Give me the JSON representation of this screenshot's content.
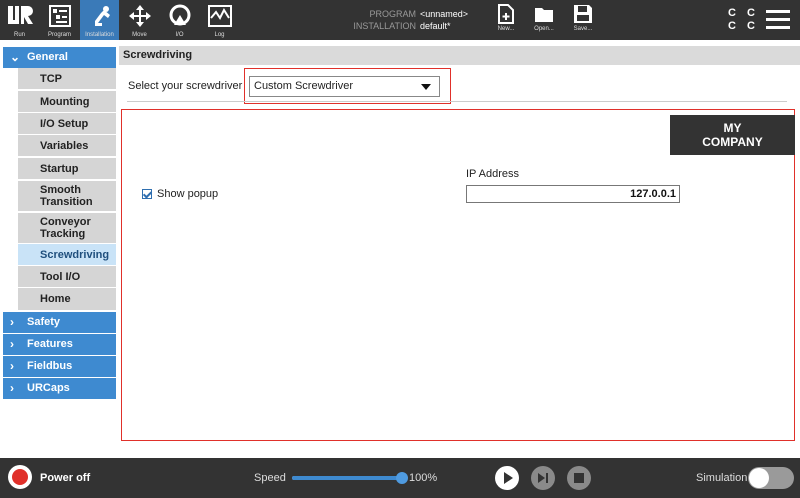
{
  "topbar": {
    "nav": [
      {
        "label": "Run",
        "icon": "ur-logo-icon"
      },
      {
        "label": "Program",
        "icon": "program-icon"
      },
      {
        "label": "Installation",
        "icon": "installation-icon",
        "active": true
      },
      {
        "label": "Move",
        "icon": "move-icon"
      },
      {
        "label": "I/O",
        "icon": "io-icon"
      },
      {
        "label": "Log",
        "icon": "log-icon"
      }
    ],
    "program_key": "PROGRAM",
    "program_value": "<unnamed>",
    "installation_key": "INSTALLATION",
    "installation_value": "default*",
    "file": [
      {
        "label": "New...",
        "icon": "new-file-icon"
      },
      {
        "label": "Open...",
        "icon": "open-folder-icon"
      },
      {
        "label": "Save...",
        "icon": "save-icon"
      }
    ],
    "cc_text": "C C\nC C"
  },
  "sidebar": {
    "general": "General",
    "items": [
      "TCP",
      "Mounting",
      "I/O Setup",
      "Variables",
      "Startup",
      "Smooth Transition",
      "Conveyor Tracking",
      "Screwdriving",
      "Tool I/O",
      "Home"
    ],
    "selected": "Screwdriving",
    "sections": [
      "Safety",
      "Features",
      "Fieldbus",
      "URCaps"
    ]
  },
  "main": {
    "title": "Screwdriving",
    "select_label": "Select your screwdriver",
    "select_value": "Custom Screwdriver",
    "brand": "MY\nCOMPANY",
    "show_popup_label": "Show popup",
    "show_popup_checked": true,
    "ip_label": "IP Address",
    "ip_value": "127.0.0.1"
  },
  "bottombar": {
    "power_label": "Power off",
    "speed_label": "Speed",
    "speed_value": "100%",
    "speed_fraction": 1.0,
    "simulation_label": "Simulation"
  },
  "colors": {
    "topbar": "#333333",
    "accent": "#3e8ad0",
    "highlight": "#e0302a",
    "selected_item": "#c9e3f7"
  }
}
